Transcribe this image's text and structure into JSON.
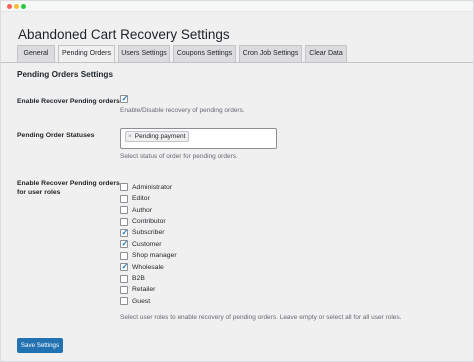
{
  "window": {
    "controls": [
      "close",
      "minimize",
      "zoom"
    ]
  },
  "page": {
    "title": "Abandoned Cart Recovery Settings"
  },
  "tabs": [
    {
      "label": "General",
      "active": false
    },
    {
      "label": "Pending Orders",
      "active": true
    },
    {
      "label": "Users Settings",
      "active": false
    },
    {
      "label": "Coupons Settings",
      "active": false
    },
    {
      "label": "Cron Job Settings",
      "active": false
    },
    {
      "label": "Clear Data",
      "active": false
    }
  ],
  "section": {
    "title": "Pending Orders Settings"
  },
  "enable_pending": {
    "label": "Enable Recover Pending orders",
    "checked": true,
    "description": "Enable/Disable recovery of pending orders."
  },
  "statuses": {
    "label": "Pending Order Statuses",
    "selected": [
      {
        "remove": "×",
        "label": "Pending payment"
      }
    ],
    "description": "Select status of order for pending orders."
  },
  "user_roles": {
    "label_line1": "Enable Recover Pending orders",
    "label_line2": "for user roles",
    "roles": [
      {
        "label": "Administrator",
        "checked": false
      },
      {
        "label": "Editor",
        "checked": false
      },
      {
        "label": "Author",
        "checked": false
      },
      {
        "label": "Contributor",
        "checked": false
      },
      {
        "label": "Subscriber",
        "checked": true
      },
      {
        "label": "Customer",
        "checked": true
      },
      {
        "label": "Shop manager",
        "checked": false
      },
      {
        "label": "Wholesale",
        "checked": true
      },
      {
        "label": "B2B",
        "checked": false
      },
      {
        "label": "Retailer",
        "checked": false
      },
      {
        "label": "Guest",
        "checked": false
      }
    ],
    "description": "Select user roles to enable recovery of pending orders. Leave empty or select all for all user roles."
  },
  "actions": {
    "save_label": "Save Settings"
  },
  "colors": {
    "primary": "#2271b1",
    "page_bg": "#f0f0f1",
    "muted_text": "#646970"
  }
}
